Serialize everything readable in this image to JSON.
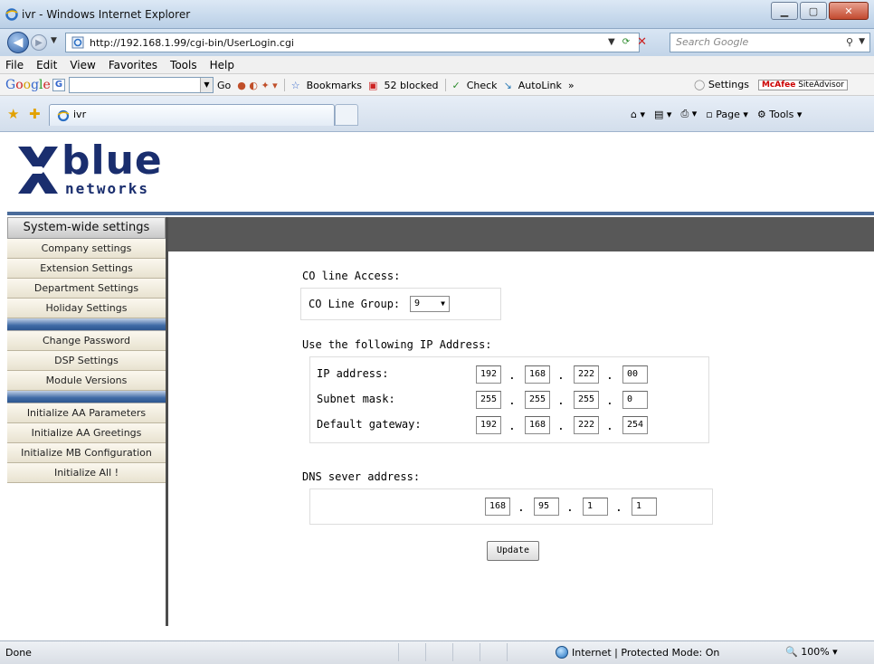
{
  "window": {
    "title": "ivr - Windows Internet Explorer"
  },
  "address_bar": {
    "url": "http://192.168.1.99/cgi-bin/UserLogin.cgi",
    "search_placeholder": "Search Google"
  },
  "menu": [
    "File",
    "Edit",
    "View",
    "Favorites",
    "Tools",
    "Help"
  ],
  "google_toolbar": {
    "go_label": "Go",
    "bookmarks_label": "Bookmarks",
    "blocked_label": "52 blocked",
    "check_label": "Check",
    "autolink_label": "AutoLink",
    "more_label": "»",
    "settings_label": "Settings",
    "mcafee_brand": "McAfee",
    "mcafee_product": "SiteAdvisor"
  },
  "tabs": [
    {
      "label": "ivr"
    }
  ],
  "command_bar": {
    "page_label": "Page",
    "tools_label": "Tools"
  },
  "logo": {
    "word": "blue",
    "sub": "networks",
    "colors": {
      "navy": "#1a2e6e"
    }
  },
  "sidebar": {
    "header": "System-wide settings",
    "group1": [
      "Company settings",
      "Extension Settings",
      "Department Settings",
      "Holiday Settings"
    ],
    "group2": [
      "Change Password",
      "DSP Settings",
      "Module Versions"
    ],
    "group3": [
      "Initialize AA Parameters",
      "Initialize AA Greetings",
      "Initialize MB Configuration",
      "Initialize All !"
    ]
  },
  "form": {
    "co_line_title": "CO line Access:",
    "co_line_group_label": "CO Line Group:",
    "co_line_group_value": "9",
    "ip_title": "Use the following IP Address:",
    "ip_rows": [
      {
        "label": "IP address:",
        "octets": [
          "192",
          "168",
          "222",
          "00"
        ]
      },
      {
        "label": "Subnet mask:",
        "octets": [
          "255",
          "255",
          "255",
          "0"
        ]
      },
      {
        "label": "Default gateway:",
        "octets": [
          "192",
          "168",
          "222",
          "254"
        ]
      }
    ],
    "dns_title": "DNS sever address:",
    "dns_octets": [
      "168",
      "95",
      "1",
      "1"
    ],
    "update_label": "Update"
  },
  "status_bar": {
    "status": "Done",
    "zone": "Internet | Protected Mode: On",
    "zoom": "100%"
  },
  "colors": {
    "banner": "#585858",
    "sidebar_separator": "#3f6aa6"
  }
}
